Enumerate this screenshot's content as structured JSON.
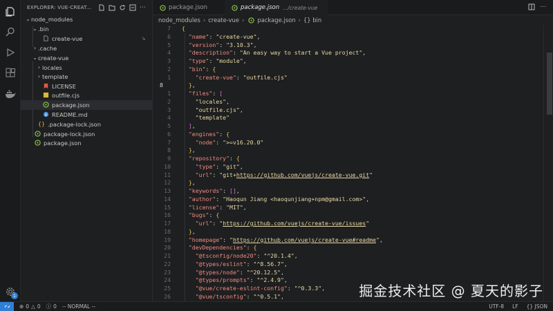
{
  "explorer": {
    "title": "EXPLORER: VUE-CREAT...",
    "tree": [
      {
        "label": "node_modules",
        "type": "folder-open"
      },
      {
        "label": ".bin",
        "type": "folder-open"
      },
      {
        "label": "create-vue",
        "type": "file",
        "marker": "↳"
      },
      {
        "label": ".cache",
        "type": "folder"
      },
      {
        "label": "create-vue",
        "type": "folder-open"
      },
      {
        "label": "locales",
        "type": "folder"
      },
      {
        "label": "template",
        "type": "folder"
      },
      {
        "label": "LICENSE",
        "type": "license"
      },
      {
        "label": "outfile.cjs",
        "type": "js"
      },
      {
        "label": "package.json",
        "type": "json"
      },
      {
        "label": "README.md",
        "type": "md"
      },
      {
        "label": ".package-lock.json",
        "type": "braces"
      },
      {
        "label": "package-lock.json",
        "type": "json"
      },
      {
        "label": "package.json",
        "type": "json"
      }
    ]
  },
  "tabs": [
    {
      "label": "package.json",
      "path": ""
    },
    {
      "label": "package.json",
      "path": ".../create-vue"
    }
  ],
  "breadcrumb": [
    "node_modules",
    "create-vue",
    "package.json",
    "{} bin"
  ],
  "editor": {
    "line_numbers": [
      "7",
      "6",
      "5",
      "4",
      "3",
      "2",
      "1",
      "8",
      "1",
      "2",
      "3",
      "4",
      "5",
      "6",
      "7",
      "8",
      "9",
      "10",
      "11",
      "12",
      "13",
      "14",
      "15",
      "16",
      "17",
      "18",
      "19",
      "20",
      "21",
      "22",
      "23",
      "24",
      "25",
      "26"
    ],
    "lines": [
      "{",
      "  \"name\": \"create-vue\",",
      "  \"version\": \"3.10.3\",",
      "  \"description\": \"An easy way to start a Vue project\",",
      "  \"type\": \"module\",",
      "  \"bin\": {",
      "    \"create-vue\": \"outfile.cjs\"",
      "  },",
      "  \"files\": [",
      "    \"locales\",",
      "    \"outfile.cjs\",",
      "    \"template\"",
      "  ],",
      "  \"engines\": {",
      "    \"node\": \">=v16.20.0\"",
      "  },",
      "  \"repository\": {",
      "    \"type\": \"git\",",
      "    \"url\": \"git+https://github.com/vuejs/create-vue.git\"",
      "  },",
      "  \"keywords\": [],",
      "  \"author\": \"Haoqun Jiang <haoqunjiang+npm@gmail.com>\",",
      "  \"license\": \"MIT\",",
      "  \"bugs\": {",
      "    \"url\": \"https://github.com/vuejs/create-vue/issues\"",
      "  },",
      "  \"homepage\": \"https://github.com/vuejs/create-vue#readme\",",
      "  \"devDependencies\": {",
      "    \"@tsconfig/node20\": \"^20.1.4\",",
      "    \"@types/eslint\": \"^8.56.7\",",
      "    \"@types/node\": \"^20.12.5\",",
      "    \"@types/prompts\": \"^2.4.9\",",
      "    \"@vue/create-eslint-config\": \"^0.3.3\",",
      "    \"@vue/tsconfig\": \"^0.5.1\","
    ]
  },
  "watermark": "掘金技术社区 @ 夏天的影子",
  "status": {
    "errors": "0",
    "warnings": "0",
    "info": "0",
    "mode": "-- NORMAL --",
    "encoding": "UTF-8",
    "eol": "LF",
    "language": "{} JSON"
  },
  "colors": {
    "accent": "#2f7fd6",
    "string": "#e8d9a7",
    "key": "#f28b82",
    "json_icon": "#8dc149",
    "license_icon": "#e05a4a",
    "md_icon": "#4d9be6"
  }
}
